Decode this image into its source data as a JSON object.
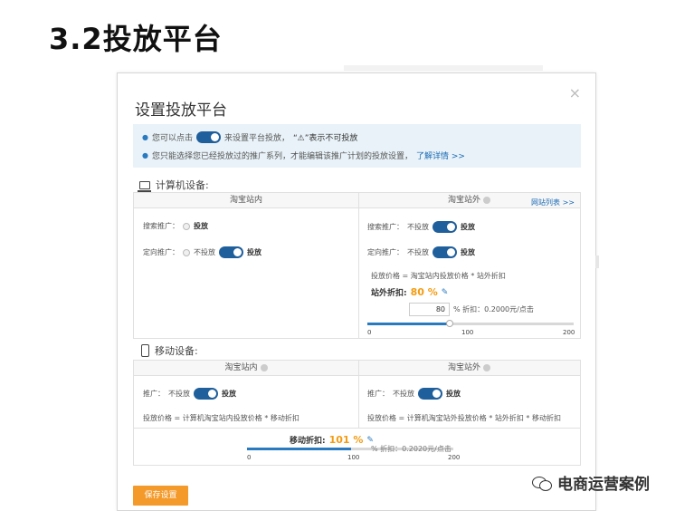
{
  "slide": {
    "title": "3.2投放平台"
  },
  "dialog": {
    "title": "设置投放平台",
    "close": "×",
    "notice": {
      "line1_prefix": "您可以点击",
      "line1_mid": "来设置平台投放，",
      "line1_warn": "“⚠”表示不可投放",
      "line2_text": "您只能选择您已经投放过的推广系列，才能编辑该推广计划的投放设置，",
      "line2_link": "了解详情 >>"
    },
    "pc": {
      "heading": "计算机设备:",
      "left_col": "淘宝站内",
      "right_col": "淘宝站外",
      "site_list_link": "网站列表 >>",
      "left_rows": [
        {
          "label": "搜索推广：",
          "state": "投放"
        },
        {
          "label": "定向推广：",
          "off": "不投放",
          "state": "投放"
        }
      ],
      "right_rows": [
        {
          "label": "搜索推广：",
          "off": "不投放",
          "state": "投放"
        },
        {
          "label": "定向推广：",
          "off": "不投放",
          "state": "投放"
        }
      ],
      "price_formula": "投放价格 = 淘宝站内投放价格 * 站外折扣",
      "discount_label": "站外折扣:",
      "discount_value": "80 %",
      "discount_input": "80",
      "discount_hint": "% 折扣：0.2000元/点击",
      "slider_level": 0.4,
      "ticks": [
        "0",
        "100",
        "200"
      ]
    },
    "mobile": {
      "heading": "移动设备:",
      "left_col": "淘宝站内",
      "right_col": "淘宝站外",
      "left_row": {
        "label": "推广：",
        "off": "不投放",
        "state": "投放"
      },
      "right_row": {
        "label": "推广：",
        "off": "不投放",
        "state": "投放"
      },
      "left_formula": "投放价格 = 计算机淘宝站内投放价格 * 移动折扣",
      "right_formula": "投放价格 = 计算机淘宝站外投放价格 * 站外折扣 * 移动折扣",
      "discount_label": "移动折扣:",
      "discount_value": "101 %",
      "discount_hint": "% 折扣：0.2020元/点击",
      "slider_level": 0.505,
      "ticks": [
        "0",
        "100",
        "200"
      ]
    },
    "save_label": "保存设置"
  },
  "watermark": {
    "text": "电商运营案例"
  },
  "colors": {
    "toggle": "#1f5f9c",
    "discount": "#f39c12",
    "save": "#f39a2b",
    "notice_bg": "#e8f2f8",
    "link": "#1a6ab5"
  }
}
